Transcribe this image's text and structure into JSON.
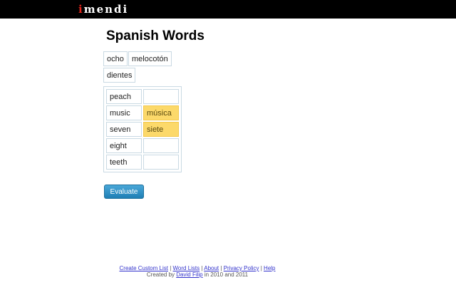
{
  "header": {
    "logo_first": "i",
    "logo_rest": "mendi"
  },
  "page": {
    "title": "Spanish Words"
  },
  "word_bank": [
    "ocho",
    "melocotón",
    "dientes"
  ],
  "pairs": [
    {
      "english": "peach",
      "spanish": ""
    },
    {
      "english": "music",
      "spanish": "música"
    },
    {
      "english": "seven",
      "spanish": "siete"
    },
    {
      "english": "eight",
      "spanish": ""
    },
    {
      "english": "teeth",
      "spanish": ""
    }
  ],
  "actions": {
    "evaluate_label": "Evaluate"
  },
  "footer": {
    "links": [
      "Create Custom List",
      "Word Lists",
      "About",
      "Privacy Policy",
      "Help"
    ],
    "separator": "|",
    "credit_prefix": "Created by",
    "author": "David Filip",
    "credit_suffix": "in 2010 and 2011"
  },
  "colors": {
    "header_bg": "#000000",
    "filled_cell": "#fcd96a",
    "button": "#2a8cc4"
  }
}
